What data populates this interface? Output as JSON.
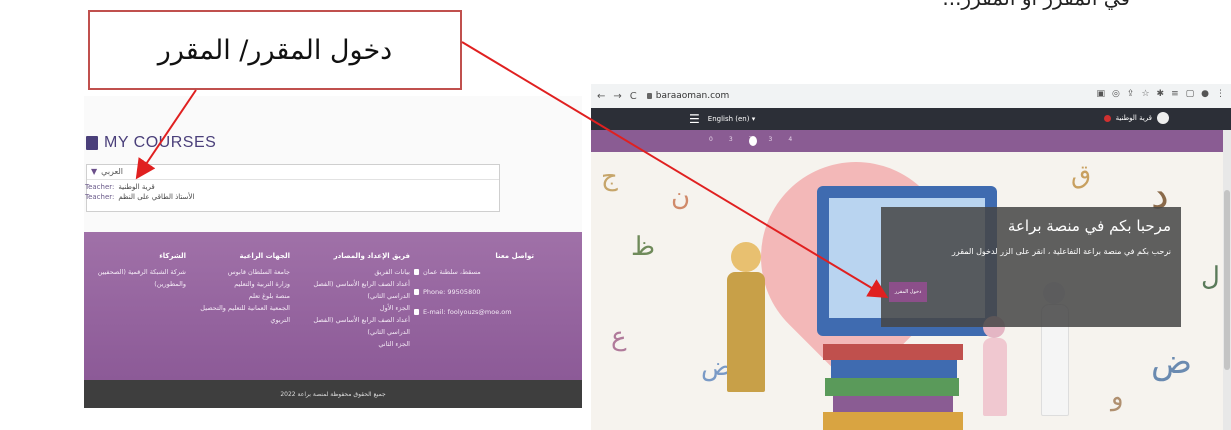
{
  "top_partial_text": "في المقرر أو المقرر...",
  "callout": {
    "text": "دخول المقرر/ المقرر"
  },
  "left_screenshot": {
    "my_courses_title": "MY COURSES",
    "course": {
      "name": "العربي",
      "teachers": [
        {
          "label": "Teacher:",
          "name": "قرية الوطنية"
        },
        {
          "label": "Teacher:",
          "name": "الأستاذ الطاقي على النظم"
        }
      ]
    },
    "footer": {
      "col_partners": {
        "heading": "الشركاء",
        "items": [
          "شركة الشبكة الرقمية (الصحفيين والمطورين)"
        ]
      },
      "col_sponsors": {
        "heading": "الجهات الراعية",
        "items": [
          "جامعة السلطان قابوس",
          "وزارة التربية والتعليم",
          "منصة بلوغ تعلم",
          "الجمعية العمانية للتعليم والتحصيل التربوي"
        ]
      },
      "col_team": {
        "heading": "فريق الإعداد والمصادر",
        "items": [
          "بيانات الفريق",
          "أعداد الصف الرابع الأساسي (الفصل الدراسي الثاني)",
          "الجزء الأول",
          "أعداد الصف الرابع الأساسي (الفصل الدراسي الثاني)",
          "الجزء الثاني"
        ]
      },
      "col_contact": {
        "heading": "تواصل معنا",
        "location": "مسقط، سلطنة عمان",
        "phone": "Phone: 99505800",
        "email": "E-mail: foolyouzs@moe.om"
      }
    },
    "copyright": "جميع الحقوق محفوظة لمنصة براعة 2022"
  },
  "right_screenshot": {
    "url": "baraaoman.com",
    "language": "English (en) ▾",
    "user_name": "قرية الوطنية",
    "hero": {
      "title": "مرحبا بكم في منصة براعة",
      "description": "نرحب بكم في منصة براعة التفاعلية ، انقر على الزر لدخول المقرر",
      "button": "دخول المقرر"
    }
  },
  "colors": {
    "callout_border": "#c0504d",
    "arrow": "#e02020",
    "footer_purple": "#9668a2",
    "topbar": "#2c2f37",
    "accent_purple": "#8c4f8a"
  },
  "icons": [
    "book-icon",
    "chevron-down-icon",
    "location-icon",
    "phone-icon",
    "email-icon",
    "menu-icon",
    "bell-icon",
    "user-avatar-icon",
    "lock-icon"
  ]
}
